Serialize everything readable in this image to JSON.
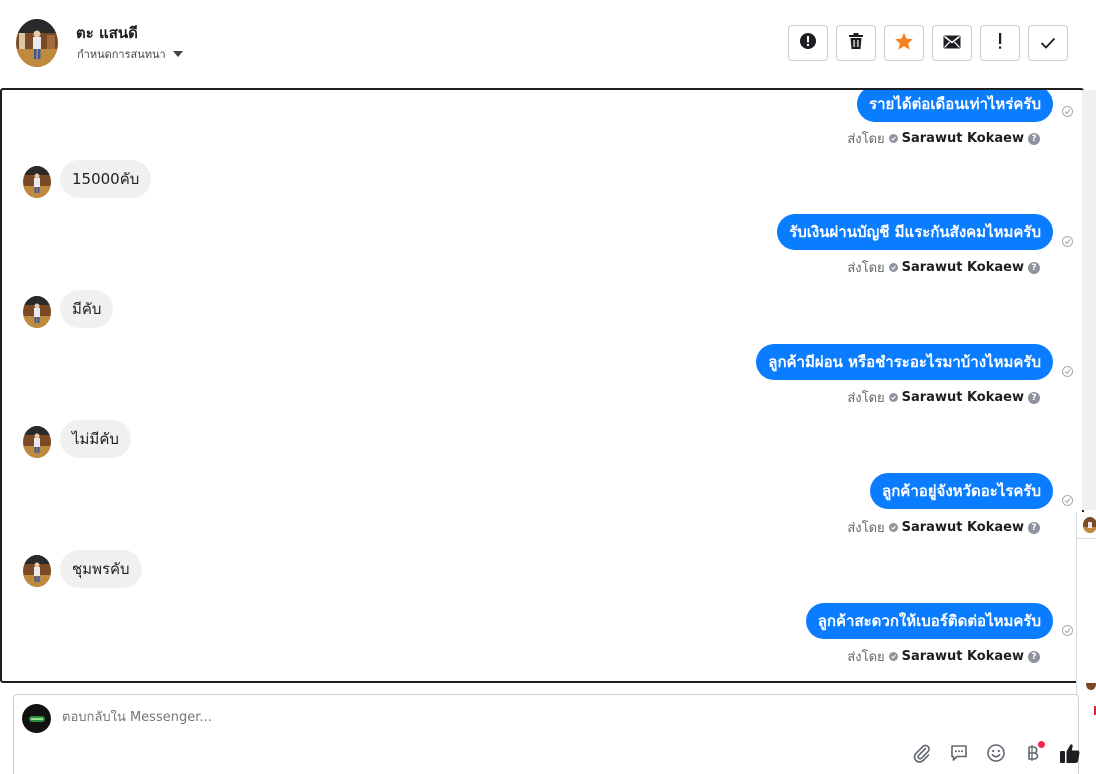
{
  "header": {
    "contact_name": "ตะ แสนดี",
    "assign_label": "กำหนดการสนทนา",
    "actions": [
      {
        "name": "spam-button",
        "icon": "alert-circle-icon"
      },
      {
        "name": "delete-button",
        "icon": "trash-icon"
      },
      {
        "name": "star-button",
        "icon": "star-icon"
      },
      {
        "name": "mark-unread-button",
        "icon": "envelope-icon"
      },
      {
        "name": "follow-up-button",
        "icon": "exclamation-icon"
      },
      {
        "name": "done-button",
        "icon": "check-icon"
      }
    ]
  },
  "conversation": {
    "sent_by_prefix": "ส่งโดย",
    "sender_name": "Sarawut Kokaew",
    "messages": [
      {
        "direction": "out",
        "text": "รายได้ต่อเดือนเท่าไหร่ครับ"
      },
      {
        "direction": "in",
        "text": "15000คับ"
      },
      {
        "direction": "out",
        "text": "รับเงินผ่านบัญชี มีแระกันสังคมไหมครับ"
      },
      {
        "direction": "in",
        "text": "มีคับ"
      },
      {
        "direction": "out",
        "text": "ลูกค้ามีผ่อน หรือชำระอะไรมาบ้างไหมครับ"
      },
      {
        "direction": "in",
        "text": "ไม่มีคับ"
      },
      {
        "direction": "out",
        "text": "ลูกค้าอยู่จังหวัดอะไรครับ"
      },
      {
        "direction": "in",
        "text": "ชุมพรคับ"
      },
      {
        "direction": "out",
        "text": "ลูกค้าสะดวกให้เบอร์ติดต่อไหมครับ"
      }
    ]
  },
  "composer": {
    "placeholder": "ตอบกลับใน Messenger...",
    "tools": [
      "attach-icon",
      "saved-reply-icon",
      "emoji-icon",
      "baht-payment-icon",
      "thumbs-up-icon"
    ]
  },
  "colors": {
    "outgoing_bubble": "#0a7cff",
    "incoming_bubble": "#f0f0f0",
    "star_accent": "#f5821f",
    "notification": "#f02849"
  }
}
